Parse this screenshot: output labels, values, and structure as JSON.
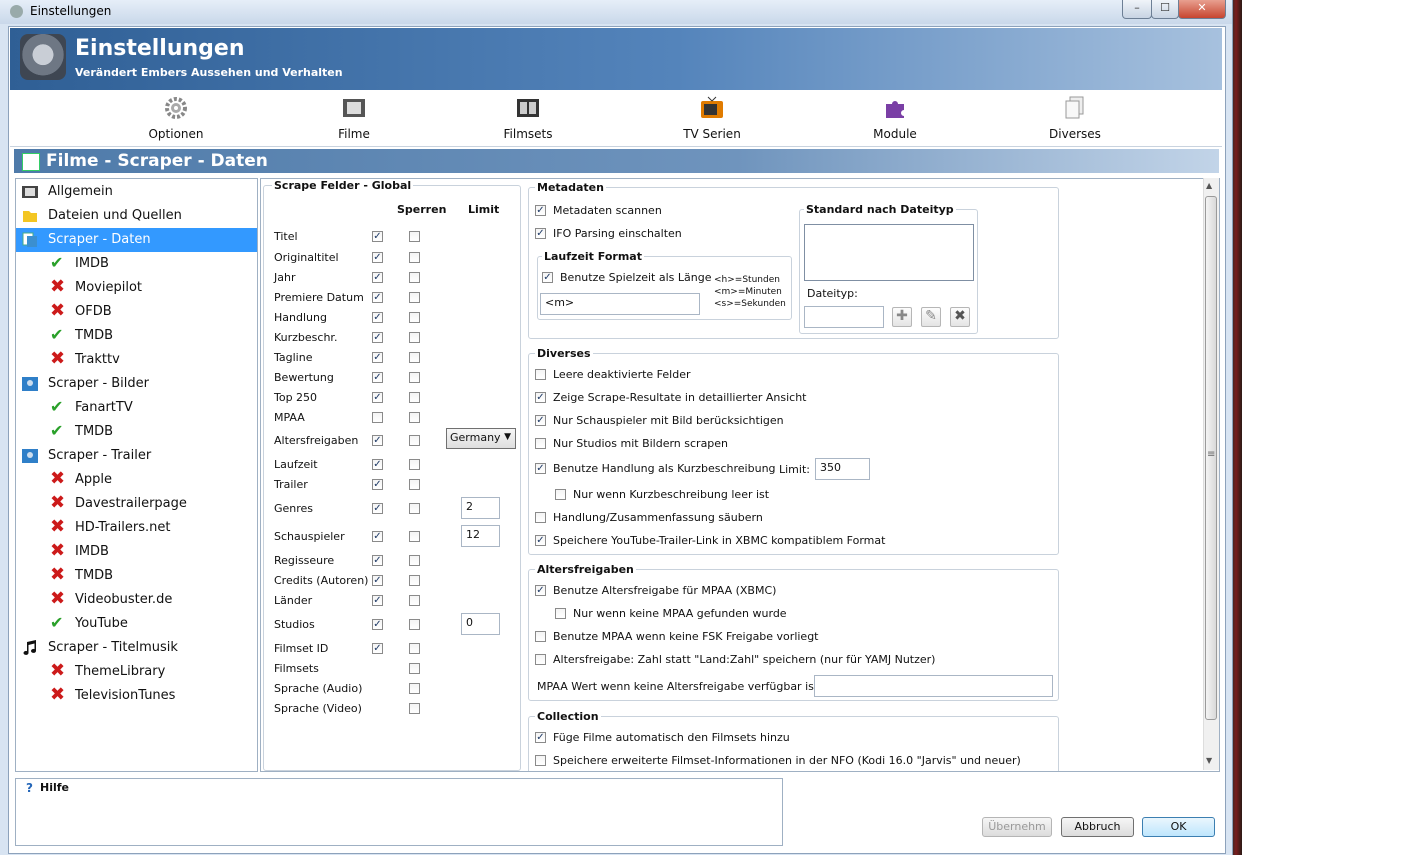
{
  "window": {
    "title": "Einstellungen",
    "controls": {
      "minimize": "–",
      "maximize": "☐",
      "close": "✕"
    }
  },
  "header": {
    "title": "Einstellungen",
    "subtitle": "Verändert Embers Aussehen und Verhalten"
  },
  "toolbar": {
    "items": [
      {
        "label": "Optionen",
        "icon": "gear-icon"
      },
      {
        "label": "Filme",
        "icon": "film-icon"
      },
      {
        "label": "Filmsets",
        "icon": "filmset-icon"
      },
      {
        "label": "TV Serien",
        "icon": "tv-icon"
      },
      {
        "label": "Module",
        "icon": "puzzle-icon"
      },
      {
        "label": "Diverses",
        "icon": "documents-icon"
      }
    ]
  },
  "section": {
    "title": "Filme - Scraper - Daten"
  },
  "tree": {
    "items": [
      {
        "label": "Allgemein",
        "type": "category",
        "icon": "film-icon"
      },
      {
        "label": "Dateien und Quellen",
        "type": "category",
        "icon": "folder-icon"
      },
      {
        "label": "Scraper - Daten",
        "type": "category",
        "icon": "scraper-icon",
        "selected": true
      },
      {
        "label": "IMDB",
        "type": "ok"
      },
      {
        "label": "Moviepilot",
        "type": "x"
      },
      {
        "label": "OFDB",
        "type": "x"
      },
      {
        "label": "TMDB",
        "type": "ok"
      },
      {
        "label": "Trakttv",
        "type": "x"
      },
      {
        "label": "Scraper - Bilder",
        "type": "category",
        "icon": "image-icon"
      },
      {
        "label": "FanartTV",
        "type": "ok"
      },
      {
        "label": "TMDB",
        "type": "ok"
      },
      {
        "label": "Scraper - Trailer",
        "type": "category",
        "icon": "image-icon"
      },
      {
        "label": "Apple",
        "type": "x"
      },
      {
        "label": "Davestrailerpage",
        "type": "x"
      },
      {
        "label": "HD-Trailers.net",
        "type": "x"
      },
      {
        "label": "IMDB",
        "type": "x"
      },
      {
        "label": "TMDB",
        "type": "x"
      },
      {
        "label": "Videobuster.de",
        "type": "x"
      },
      {
        "label": "YouTube",
        "type": "ok"
      },
      {
        "label": "Scraper - Titelmusik",
        "type": "category",
        "icon": "music-icon"
      },
      {
        "label": "ThemeLibrary",
        "type": "x"
      },
      {
        "label": "TelevisionTunes",
        "type": "x"
      }
    ]
  },
  "scrape": {
    "title": "Scrape Felder - Global",
    "col_lock": "Sperren",
    "col_limit": "Limit",
    "fields": [
      {
        "label": "Titel",
        "enabled": true,
        "locked": false
      },
      {
        "label": "Originaltitel",
        "enabled": true,
        "locked": false
      },
      {
        "label": "Jahr",
        "enabled": true,
        "locked": false
      },
      {
        "label": "Premiere Datum",
        "enabled": true,
        "locked": false
      },
      {
        "label": "Handlung",
        "enabled": true,
        "locked": false
      },
      {
        "label": "Kurzbeschr.",
        "enabled": true,
        "locked": false
      },
      {
        "label": "Tagline",
        "enabled": true,
        "locked": false
      },
      {
        "label": "Bewertung",
        "enabled": true,
        "locked": false
      },
      {
        "label": "Top 250",
        "enabled": true,
        "locked": false
      },
      {
        "label": "MPAA",
        "enabled": false,
        "locked": false
      },
      {
        "label": "Altersfreigaben",
        "enabled": true,
        "locked": false,
        "limit_select": "Germany"
      },
      {
        "label": "Laufzeit",
        "enabled": true,
        "locked": false
      },
      {
        "label": "Trailer",
        "enabled": true,
        "locked": false
      },
      {
        "label": "Genres",
        "enabled": true,
        "locked": false,
        "limit": "2"
      },
      {
        "label": "Schauspieler",
        "enabled": true,
        "locked": false,
        "limit": "12"
      },
      {
        "label": "Regisseure",
        "enabled": true,
        "locked": false
      },
      {
        "label": "Credits (Autoren)",
        "enabled": true,
        "locked": false
      },
      {
        "label": "Länder",
        "enabled": true,
        "locked": false
      },
      {
        "label": "Studios",
        "enabled": true,
        "locked": false,
        "limit": "0"
      },
      {
        "label": "Filmset ID",
        "enabled": true,
        "locked": false
      },
      {
        "label": "Filmsets",
        "enabled": null,
        "locked": false
      },
      {
        "label": "Sprache (Audio)",
        "enabled": null,
        "locked": false
      },
      {
        "label": "Sprache (Video)",
        "enabled": null,
        "locked": false
      }
    ]
  },
  "meta": {
    "title": "Metadaten",
    "scan": {
      "label": "Metadaten scannen",
      "checked": true
    },
    "ifo": {
      "label": "IFO Parsing einschalten",
      "checked": true
    },
    "runtime": {
      "title": "Laufzeit Format",
      "use": {
        "label": "Benutze Spielzeit als Länge",
        "checked": true
      },
      "value": "<m>",
      "legend": [
        "<h>=Stunden",
        "<m>=Minuten",
        "<s>=Sekunden"
      ]
    },
    "filetype": {
      "title": "Standard nach Dateityp",
      "label": "Dateityp:",
      "value": ""
    }
  },
  "misc": {
    "title": "Diverses",
    "items": [
      {
        "label": "Leere deaktivierte Felder",
        "checked": false,
        "indent": false
      },
      {
        "label": "Zeige Scrape-Resultate in detaillierter Ansicht",
        "checked": true,
        "indent": false
      },
      {
        "label": "Nur Schauspieler mit Bild berücksichtigen",
        "checked": true,
        "indent": false
      },
      {
        "label": "Nur Studios mit Bildern scrapen",
        "checked": false,
        "indent": false
      },
      {
        "label": "Benutze Handlung als Kurzbeschreibung",
        "checked": true,
        "indent": false
      },
      {
        "label": "Nur wenn Kurzbeschreibung leer ist",
        "checked": false,
        "indent": true
      },
      {
        "label": "Handlung/Zusammenfassung säubern",
        "checked": false,
        "indent": false
      },
      {
        "label": "Speichere YouTube-Trailer-Link in XBMC kompatiblem Format",
        "checked": true,
        "indent": false
      }
    ],
    "limit_label": "Limit:",
    "limit_value": "350"
  },
  "cert": {
    "title": "Altersfreigaben",
    "items": [
      {
        "label": "Benutze Altersfreigabe für MPAA (XBMC)",
        "checked": true,
        "indent": false
      },
      {
        "label": "Nur wenn keine MPAA gefunden wurde",
        "checked": false,
        "indent": true
      },
      {
        "label": "Benutze MPAA wenn keine FSK Freigabe vorliegt",
        "checked": false,
        "indent": false
      },
      {
        "label": "Altersfreigabe: Zahl statt \"Land:Zahl\" speichern (nur für YAMJ Nutzer)",
        "checked": false,
        "indent": false
      }
    ],
    "mpaa_label": "MPAA Wert wenn keine Altersfreigabe verfügbar ist:",
    "mpaa_value": ""
  },
  "collection": {
    "title": "Collection",
    "items": [
      {
        "label": "Füge Filme automatisch den Filmsets hinzu",
        "checked": true
      },
      {
        "label": "Speichere erweiterte Filmset-Informationen in der NFO (Kodi 16.0 \"Jarvis\" und neuer)",
        "checked": false
      }
    ]
  },
  "help": {
    "title": "Hilfe",
    "icon": "help-icon"
  },
  "buttons": {
    "apply": "Übernehm",
    "cancel": "Abbruch",
    "ok": "OK"
  },
  "scrollbar": {
    "up": "▲",
    "down": "▼",
    "grip": "≡"
  }
}
